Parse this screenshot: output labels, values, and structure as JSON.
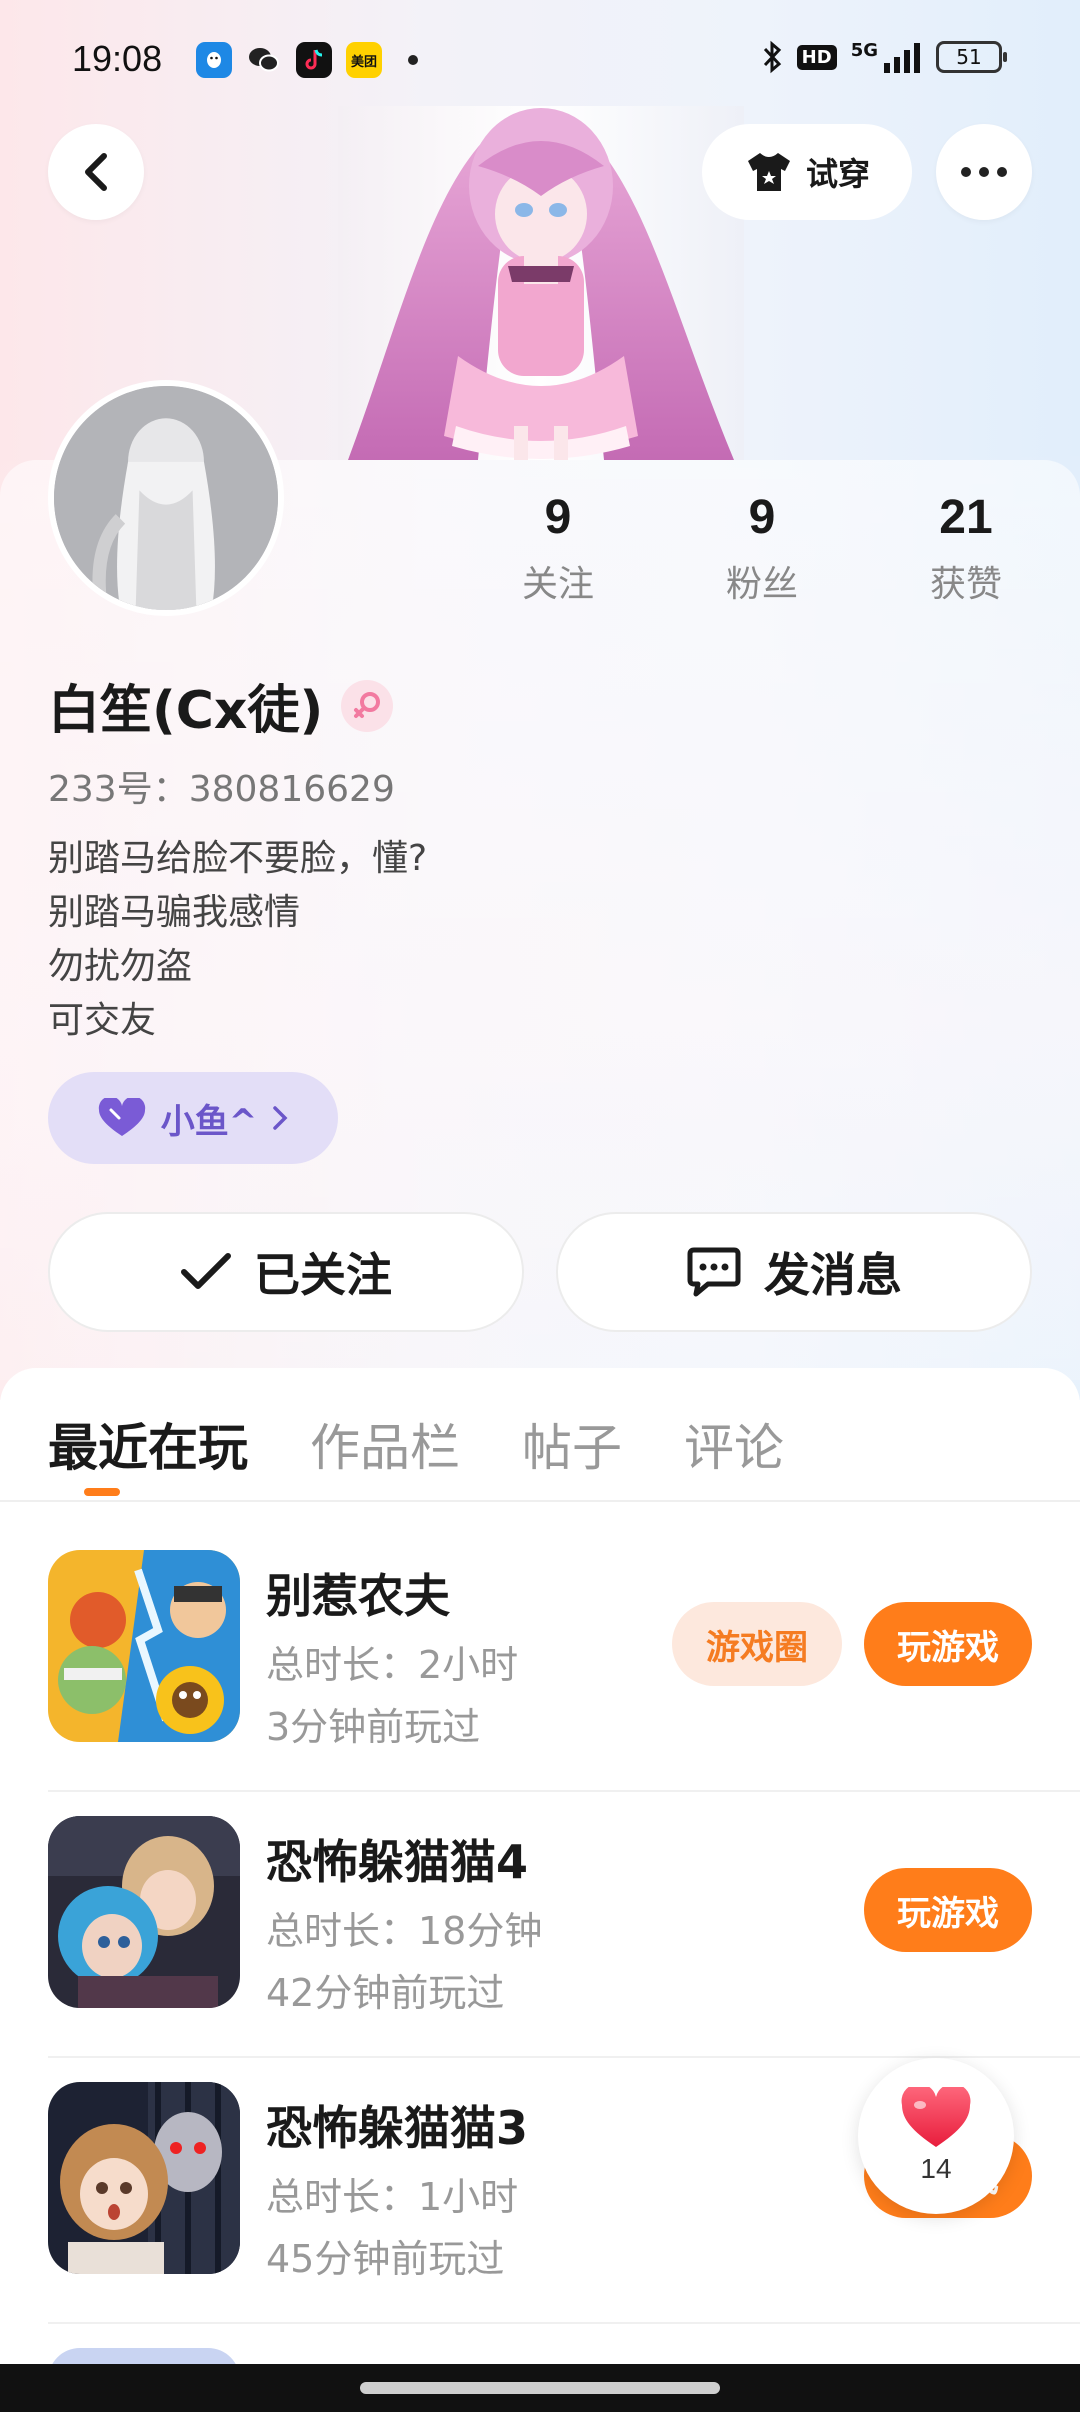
{
  "status_bar": {
    "time": "19:08",
    "app_icons": [
      "qq-icon",
      "wechat-icon",
      "douyin-icon",
      "meituan-icon"
    ],
    "meituan_label": "美团",
    "hd": "HD",
    "network": "5G",
    "battery": "51"
  },
  "header": {
    "tryon_label": "试穿"
  },
  "profile": {
    "stats": [
      {
        "value": "9",
        "label": "关注"
      },
      {
        "value": "9",
        "label": "粉丝"
      },
      {
        "value": "21",
        "label": "获赞"
      }
    ],
    "name": "白笙(Cx徒)",
    "uid": "233号：380816629",
    "bio": [
      "别踏马给脸不要脸，懂?",
      "别踏马骗我感情",
      "勿扰勿盗",
      "可交友"
    ],
    "tag_label": "小鱼^",
    "follow_label": "已关注",
    "message_label": "发消息"
  },
  "tabs": [
    "最近在玩",
    "作品栏",
    "帖子",
    "评论"
  ],
  "games": [
    {
      "title": "别惹农夫",
      "duration": "总时长：2小时",
      "last_played": "3分钟前玩过",
      "circle_label": "游戏圈",
      "play_label": "玩游戏"
    },
    {
      "title": "恐怖躲猫猫4",
      "duration": "总时长：18分钟",
      "last_played": "42分钟前玩过",
      "play_label": "玩游戏"
    },
    {
      "title": "恐怖躲猫猫3",
      "duration": "总时长：1小时",
      "last_played": "45分钟前玩过",
      "play_label": "玩游戏"
    }
  ],
  "like_fab": {
    "count": "14"
  },
  "colors": {
    "accent": "#ff7d1a",
    "tag_bg": "#e3def7",
    "tag_text": "#6b56c9"
  }
}
